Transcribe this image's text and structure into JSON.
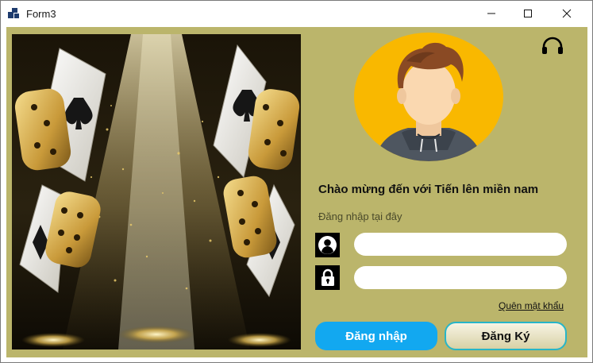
{
  "window": {
    "title": "Form3"
  },
  "login": {
    "welcome": "Chào mừng đến với Tiến lên miền nam",
    "subtitle": "Đăng nhập tại đây",
    "username_value": "",
    "password_value": "",
    "forgot_link": "Quên mật khẩu",
    "login_button": "Đăng nhập",
    "register_button": "Đăng Ký"
  },
  "icons": {
    "app": "app-icon",
    "minimize": "minimize-icon",
    "maximize": "maximize-icon",
    "close": "close-icon",
    "headset": "headset-icon",
    "user": "user-icon",
    "lock": "lock-icon"
  },
  "colors": {
    "background": "#bbb56b",
    "login_button": "#12a8f0",
    "register_border": "#27b5c8",
    "avatar_circle": "#f9b800"
  }
}
